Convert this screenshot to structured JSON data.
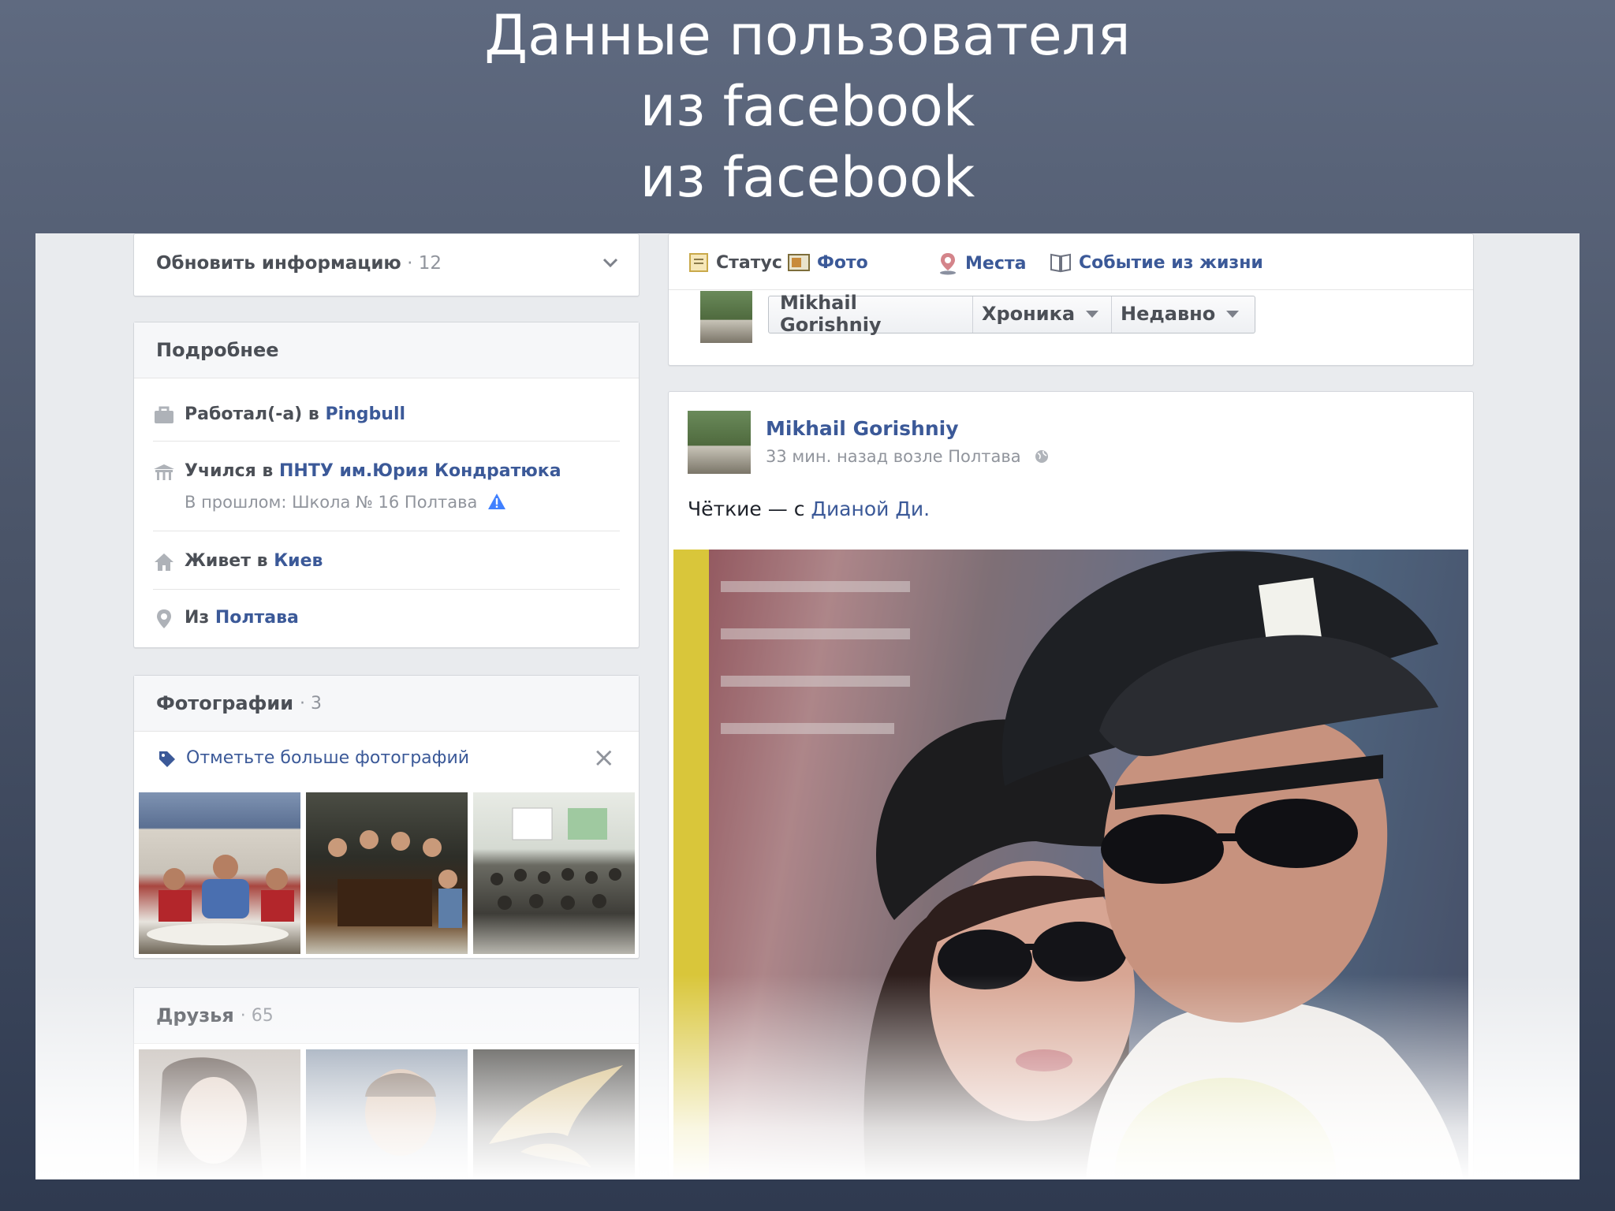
{
  "slide": {
    "title_lines": [
      "Данные пользователя",
      "из facebook",
      "из facebook"
    ]
  },
  "left": {
    "update_info": {
      "label": "Обновить информацию",
      "count": "· 12"
    },
    "details": {
      "header": "Подробнее",
      "work": {
        "prefix": "Работал(-а) в ",
        "link": "Pingbull"
      },
      "study": {
        "prefix": "Учился в ",
        "link": "ПНТУ им.Юрия Кондратюка",
        "past": "В прошлом: Школа № 16 Полтава"
      },
      "lives": {
        "prefix": "Живет в ",
        "link": "Киев"
      },
      "from": {
        "prefix": "Из ",
        "link": "Полтава"
      }
    },
    "photos": {
      "header": "Фотографии",
      "count": "· 3",
      "tag_prompt": "Отметьте больше фотографий",
      "close": "×"
    },
    "friends": {
      "header": "Друзья",
      "count": "· 65"
    }
  },
  "composer": {
    "actions": [
      "Статус",
      "Фото",
      "Места",
      "Событие из жизни"
    ],
    "filter": {
      "name": "Mikhail Gorishniy",
      "view": "Хроника",
      "sort": "Недавно"
    }
  },
  "post": {
    "author": "Mikhail Gorishniy",
    "meta": "33 мин. назад возле Полтава",
    "text_prefix": "Чёткие — с ",
    "text_link": "Дианой Ди."
  },
  "colors": {
    "link": "#3b5998",
    "text": "#4b4f56",
    "muted": "#90949c",
    "page_bg": "#e9ebee"
  },
  "icons": [
    "chevron-down-icon",
    "briefcase-icon",
    "school-icon",
    "house-icon",
    "location-pin-icon",
    "tag-icon",
    "close-icon",
    "status-icon",
    "photo-icon",
    "places-icon",
    "life-event-icon",
    "globe-icon",
    "warning-icon"
  ]
}
